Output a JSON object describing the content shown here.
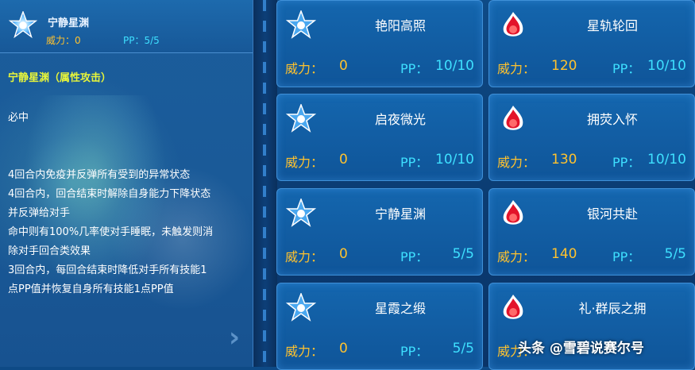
{
  "detail": {
    "icon": "star-element-icon",
    "skill_name": "宁静星渊",
    "power_text": "威力：0",
    "pp_text": "PP：5/5",
    "type_line": "宁静星渊（属性攻击）",
    "desc_lines": [
      "必中",
      "",
      "4回合内免疫并反弹所有受到的异常状态",
      "4回合内，回合结束时解除自身能力下降状态",
      "并反弹给对手",
      "命中则有100%几率使对手睡眠，未触发则消",
      "除对手回合类效果",
      "3回合内，每回合结束时降低对手所有技能1",
      "点PP值并恢复自身所有技能1点PP值"
    ]
  },
  "labels": {
    "power": "威力：",
    "pp": "PP："
  },
  "skills": [
    {
      "name": "艳阳高照",
      "icon": "star-element-icon",
      "power": "0",
      "pp": "10/10"
    },
    {
      "name": "星轨轮回",
      "icon": "fire-element-icon",
      "power": "120",
      "pp": "10/10"
    },
    {
      "name": "启夜微光",
      "icon": "star-element-icon",
      "power": "0",
      "pp": "10/10"
    },
    {
      "name": "拥荧入怀",
      "icon": "fire-element-icon",
      "power": "130",
      "pp": "10/10"
    },
    {
      "name": "宁静星渊",
      "icon": "star-element-icon",
      "power": "0",
      "pp": "5/5"
    },
    {
      "name": "银河共赴",
      "icon": "fire-element-icon",
      "power": "140",
      "pp": "5/5"
    },
    {
      "name": "星霞之缎",
      "icon": "star-element-icon",
      "power": "0",
      "pp": "5/5"
    },
    {
      "name": "礼·群辰之拥",
      "icon": "fire-element-icon",
      "power": "",
      "pp": ""
    }
  ],
  "watermark": "头条 @雪碧说赛尔号",
  "colors": {
    "power": "#ffc22e",
    "pp": "#3ee0ff",
    "type_line": "#e7f53a"
  }
}
